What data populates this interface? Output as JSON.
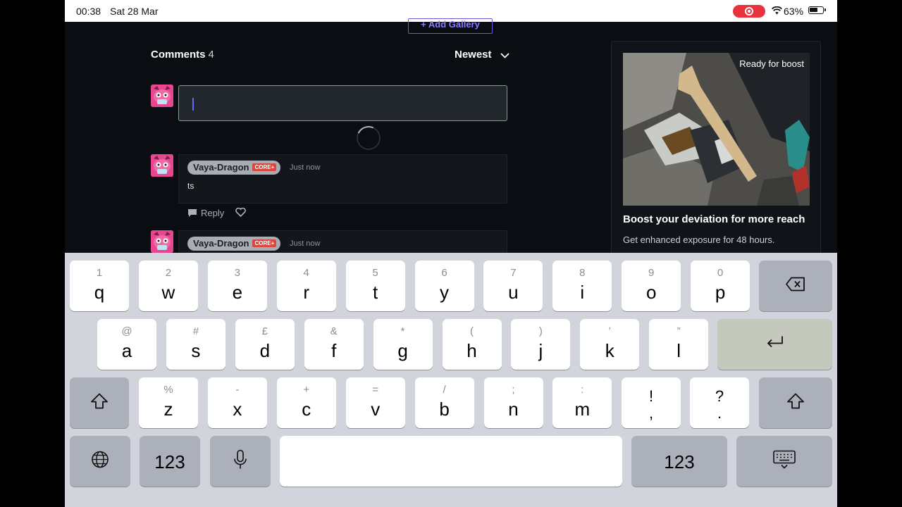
{
  "status_bar": {
    "time": "00:38",
    "date": "Sat 28 Mar",
    "battery_pct": "63%",
    "battery_level": 0.63,
    "recording": true
  },
  "gallery": {
    "add_label": "+ Add Gallery"
  },
  "comments": {
    "title": "Comments",
    "count": "4",
    "sort_label": "Newest",
    "input": {
      "value": "",
      "placeholder": ""
    },
    "items": [
      {
        "user": "Vaya-Dragon",
        "badge": "CORE+",
        "time": "Just now",
        "text": "ts"
      },
      {
        "user": "Vaya-Dragon",
        "badge": "CORE+",
        "time": "Just now",
        "text": ""
      }
    ],
    "reply_label": "Reply"
  },
  "boost": {
    "ribbon": "Ready for boost",
    "title": "Boost your deviation for more reach",
    "description": "Get enhanced exposure for 48 hours."
  },
  "keyboard": {
    "row1": [
      {
        "hint": "1",
        "key": "q"
      },
      {
        "hint": "2",
        "key": "w"
      },
      {
        "hint": "3",
        "key": "e"
      },
      {
        "hint": "4",
        "key": "r"
      },
      {
        "hint": "5",
        "key": "t"
      },
      {
        "hint": "6",
        "key": "y"
      },
      {
        "hint": "7",
        "key": "u"
      },
      {
        "hint": "8",
        "key": "i"
      },
      {
        "hint": "9",
        "key": "o"
      },
      {
        "hint": "0",
        "key": "p"
      }
    ],
    "row2": [
      {
        "hint": "@",
        "key": "a"
      },
      {
        "hint": "#",
        "key": "s"
      },
      {
        "hint": "£",
        "key": "d"
      },
      {
        "hint": "&",
        "key": "f"
      },
      {
        "hint": "*",
        "key": "g"
      },
      {
        "hint": "(",
        "key": "h"
      },
      {
        "hint": ")",
        "key": "j"
      },
      {
        "hint": "’",
        "key": "k"
      },
      {
        "hint": "”",
        "key": "l"
      }
    ],
    "row3": [
      {
        "hint": "%",
        "key": "z"
      },
      {
        "hint": "-",
        "key": "x"
      },
      {
        "hint": "+",
        "key": "c"
      },
      {
        "hint": "=",
        "key": "v"
      },
      {
        "hint": "/",
        "key": "b"
      },
      {
        "hint": ";",
        "key": "n"
      },
      {
        "hint": ":",
        "key": "m"
      }
    ],
    "punct1": {
      "top": "!",
      "bottom": ","
    },
    "punct2": {
      "top": "?",
      "bottom": "."
    },
    "numbers_label": "123",
    "icons": [
      "backspace-icon",
      "return-icon",
      "shift-icon",
      "globe-icon",
      "microphone-icon",
      "keyboard-dismiss-icon"
    ]
  }
}
